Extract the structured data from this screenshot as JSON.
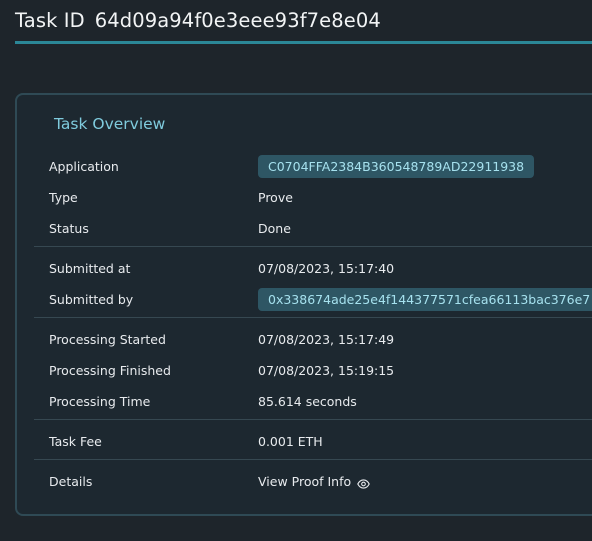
{
  "header": {
    "title_label": "Task ID",
    "task_id": "64d09a94f0e3eee93f7e8e04"
  },
  "overview": {
    "title": "Task Overview",
    "application": {
      "label": "Application",
      "value": "C0704FFA2384B360548789AD22911938"
    },
    "type": {
      "label": "Type",
      "value": "Prove"
    },
    "status": {
      "label": "Status",
      "value": "Done"
    },
    "submitted_at": {
      "label": "Submitted at",
      "value": "07/08/2023, 15:17:40"
    },
    "submitted_by": {
      "label": "Submitted by",
      "value": "0x338674ade25e4f144377571cfea66113bac376e7"
    },
    "processing_started": {
      "label": "Processing Started",
      "value": "07/08/2023, 15:17:49"
    },
    "processing_finished": {
      "label": "Processing Finished",
      "value": "07/08/2023, 15:19:15"
    },
    "processing_time": {
      "label": "Processing Time",
      "value": "85.614 seconds"
    },
    "task_fee": {
      "label": "Task Fee",
      "value": "0.001 ETH"
    },
    "details": {
      "label": "Details",
      "value": "View Proof Info",
      "icon": "eye-icon"
    }
  },
  "colors": {
    "background": "#1e252b",
    "accent": "#2b8797",
    "card_title": "#7fcbdd",
    "pill_background": "#2e5664",
    "pill_text": "#a6e1ee"
  }
}
